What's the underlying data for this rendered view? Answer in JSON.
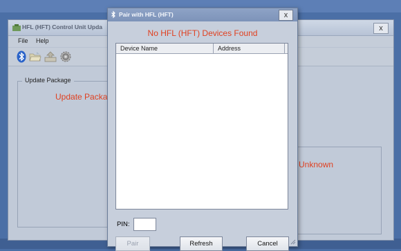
{
  "background_window": {
    "title": "HFL (HFT) Control Unit Upda",
    "close_label": "x",
    "menu": [
      "File",
      "Help"
    ],
    "toolbar_icons": [
      "bluetooth-icon",
      "folder-open-icon",
      "upload-icon",
      "settings-gear-icon"
    ],
    "group_label": "Update Package",
    "update_text": "Update Packag",
    "status_text": "Unknown"
  },
  "dialog": {
    "title": "Pair with HFL (HFT)",
    "close_label": "x",
    "message": "No HFL (HFT) Devices Found",
    "columns": [
      "Device Name",
      "Address"
    ],
    "pin_label": "PIN:",
    "pin_value": "",
    "buttons": {
      "pair": "Pair",
      "refresh": "Refresh",
      "cancel": "Cancel"
    }
  },
  "colors": {
    "accent_text": "#e04020",
    "dialog_title_bg": "#8ea3c6"
  }
}
